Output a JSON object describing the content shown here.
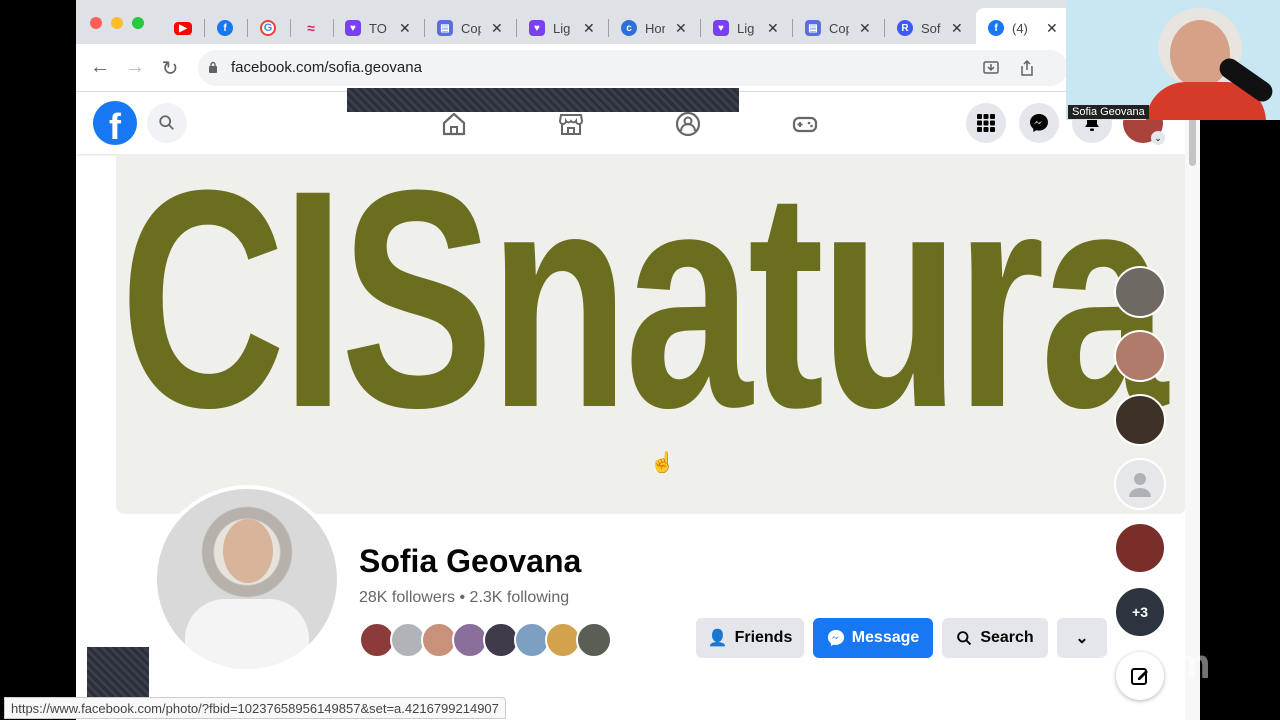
{
  "browser": {
    "tabs": [
      {
        "title": "",
        "icon": "youtube-icon",
        "color": "#ff0000"
      },
      {
        "title": "",
        "icon": "facebook-icon",
        "color": "#1877f2"
      },
      {
        "title": "",
        "icon": "google-icon",
        "color": "#4285f4"
      },
      {
        "title": "",
        "icon": "swoosh-icon",
        "color": "#e0245e"
      },
      {
        "title": "TO",
        "icon": "heart-shield-icon",
        "color": "#7b3ff2"
      },
      {
        "title": "Cop",
        "icon": "printer-icon",
        "color": "#5b6ee1"
      },
      {
        "title": "Lig",
        "icon": "heart-shield-icon",
        "color": "#7b3ff2"
      },
      {
        "title": "Hor",
        "icon": "c-logo-icon",
        "color": "#2f6fdb"
      },
      {
        "title": "Lig",
        "icon": "heart-shield-icon",
        "color": "#7b3ff2"
      },
      {
        "title": "Cop",
        "icon": "printer-icon",
        "color": "#5b6ee1"
      },
      {
        "title": "Sof",
        "icon": "r-logo-icon",
        "color": "#3d5afe"
      },
      {
        "title": "(4)",
        "icon": "facebook-icon",
        "color": "#1877f2"
      }
    ],
    "url": "facebook.com/sofia.geovana",
    "status_url": "https://www.facebook.com/photo/?fbid=10237658956149857&set=a.4216799214907"
  },
  "facebook": {
    "cover_text": "CISnatura",
    "profile_name": "Sofia Geovana",
    "stats": "28K followers • 2.3K following",
    "buttons": {
      "friends": "Friends",
      "message": "Message",
      "search": "Search"
    },
    "brand_color": "#1877f2"
  },
  "zoom": {
    "speaker_name": "Sofia Geovana",
    "more_participants": "+3",
    "logo": "zoom"
  }
}
